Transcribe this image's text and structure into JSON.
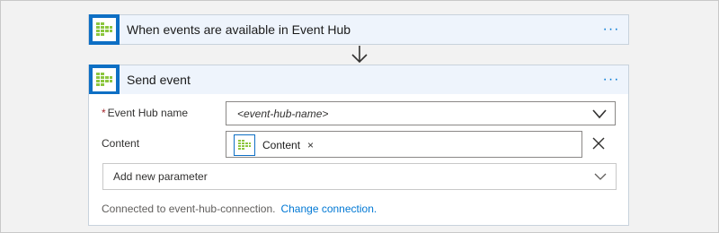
{
  "trigger": {
    "title": "When events are available in Event Hub",
    "icon": "event-hub-icon",
    "more": "···"
  },
  "action": {
    "title": "Send event",
    "icon": "event-hub-icon",
    "more": "···",
    "fields": {
      "event_hub_name": {
        "required_marker": "*",
        "label": "Event Hub name",
        "value": "<event-hub-name>"
      },
      "content": {
        "label": "Content",
        "token_label": "Content",
        "token_remove": "×"
      }
    },
    "add_parameter": {
      "label": "Add new parameter"
    },
    "connection": {
      "text": "Connected to event-hub-connection.",
      "change_link": "Change connection."
    }
  },
  "colors": {
    "accent": "#0078d4",
    "header_bg": "#eef4fc",
    "icon_bg": "#0e6fc4",
    "icon_green": "#8cc63f",
    "required": "#a4262c"
  }
}
